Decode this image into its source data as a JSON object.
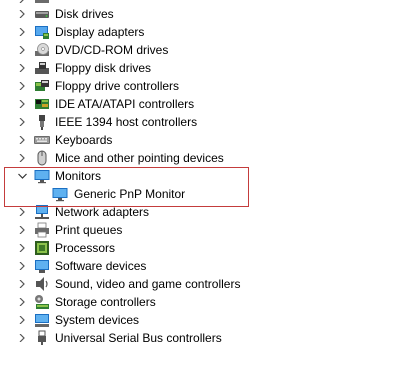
{
  "colors": {
    "highlight_border": "#c43c3c",
    "chevron": "#555555",
    "monitor_blue": "#2e86d6"
  },
  "tree": {
    "partial_top_row": {
      "icon": "generic-device-icon"
    },
    "categories": [
      {
        "label": "Disk drives",
        "icon": "disk-drive-icon",
        "expanded": false
      },
      {
        "label": "Display adapters",
        "icon": "display-adapter-icon",
        "expanded": false
      },
      {
        "label": "DVD/CD-ROM drives",
        "icon": "dvd-drive-icon",
        "expanded": false
      },
      {
        "label": "Floppy disk drives",
        "icon": "floppy-disk-icon",
        "expanded": false
      },
      {
        "label": "Floppy drive controllers",
        "icon": "floppy-controller-icon",
        "expanded": false
      },
      {
        "label": "IDE ATA/ATAPI controllers",
        "icon": "ide-controller-icon",
        "expanded": false
      },
      {
        "label": "IEEE 1394 host controllers",
        "icon": "ieee1394-icon",
        "expanded": false
      },
      {
        "label": "Keyboards",
        "icon": "keyboard-icon",
        "expanded": false
      },
      {
        "label": "Mice and other pointing devices",
        "icon": "mouse-icon",
        "expanded": false
      },
      {
        "label": "Monitors",
        "icon": "monitor-icon",
        "expanded": true
      },
      {
        "label": "Network adapters",
        "icon": "network-adapter-icon",
        "expanded": false
      },
      {
        "label": "Print queues",
        "icon": "printer-icon",
        "expanded": false
      },
      {
        "label": "Processors",
        "icon": "processor-icon",
        "expanded": false
      },
      {
        "label": "Software devices",
        "icon": "software-device-icon",
        "expanded": false
      },
      {
        "label": "Sound, video and game controllers",
        "icon": "sound-icon",
        "expanded": false
      },
      {
        "label": "Storage controllers",
        "icon": "storage-controller-icon",
        "expanded": false
      },
      {
        "label": "System devices",
        "icon": "system-device-icon",
        "expanded": false
      },
      {
        "label": "Universal Serial Bus controllers",
        "icon": "usb-icon",
        "expanded": false
      }
    ],
    "monitors_children": [
      {
        "label": "Generic PnP Monitor",
        "icon": "monitor-icon"
      }
    ]
  }
}
